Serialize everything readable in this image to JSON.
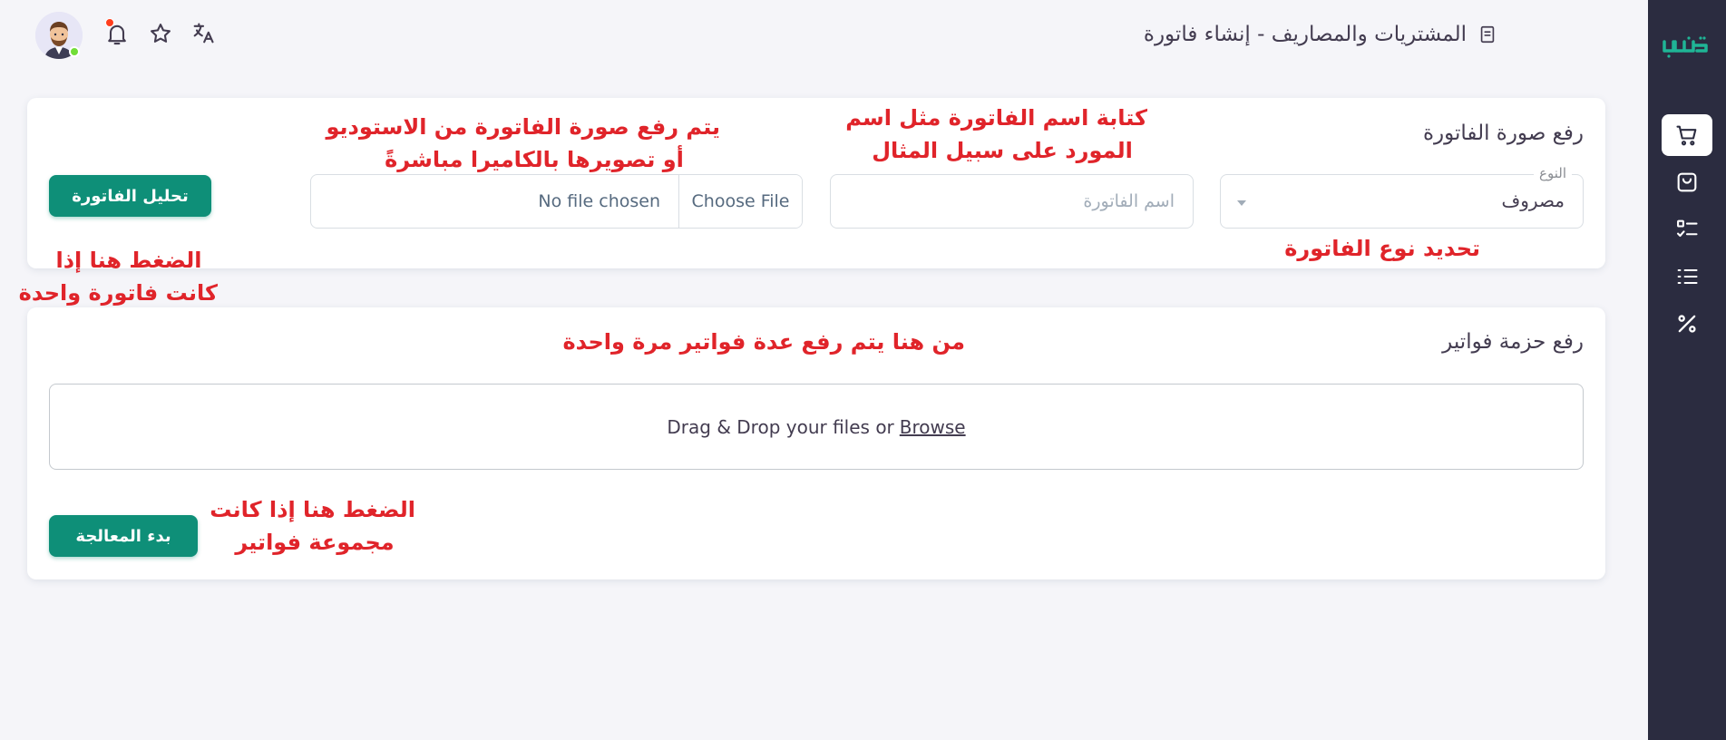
{
  "sidebar": {
    "logo": "logo-icon",
    "items": [
      {
        "icon": "cart-icon",
        "active": true
      },
      {
        "icon": "shopping-bag-icon",
        "active": false
      },
      {
        "icon": "checklist-icon",
        "active": false
      },
      {
        "icon": "list-icon",
        "active": false
      },
      {
        "icon": "percent-icon",
        "active": false
      }
    ]
  },
  "header": {
    "title": "المشتريات والمصاريف - إنشاء فاتورة",
    "icons": [
      "document-icon",
      "translate-icon",
      "star-icon",
      "bell-icon",
      "avatar"
    ]
  },
  "single_invoice": {
    "title": "رفع صورة الفاتورة",
    "type_select": {
      "label": "النوع",
      "value": "مصروف"
    },
    "name_input": {
      "placeholder": "اسم الفاتورة",
      "value": ""
    },
    "file_input": {
      "button": "Choose File",
      "status": "No file chosen"
    },
    "analyze_button": "تحليل الفاتورة"
  },
  "batch_upload": {
    "title": "رفع حزمة فواتير",
    "dropzone_text": "Drag & Drop your files or",
    "browse_link": "Browse",
    "process_button": "بدء المعالجة"
  },
  "annotations": {
    "type_note": "تحديد نوع الفاتورة",
    "name_note_line1": "كتابة اسم الفاتورة مثل اسم",
    "name_note_line2": "المورد على سبيل المثال",
    "upload_note_line1": "يتم رفع صورة الفاتورة من الاستوديو",
    "upload_note_line2": "أو تصويرها بالكاميرا مباشرةً",
    "analyze_note_line1": "الضغط هنا إذا",
    "analyze_note_line2": "كانت فاتورة واحدة",
    "batch_note": "من هنا يتم رفع عدة فواتير مرة واحدة",
    "process_note_line1": "الضغط هنا إذا كانت",
    "process_note_line2": "مجموعة فواتير"
  },
  "colors": {
    "primary": "#0e8f78",
    "sidebar_bg": "#2b2c40",
    "annotation": "#e0242a",
    "page_bg": "#f5f5f9"
  }
}
